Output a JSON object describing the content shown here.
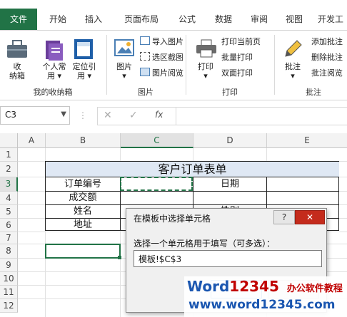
{
  "colors": {
    "accent": "#217346",
    "dialog_close": "#c42b1c",
    "watermark_blue": "#1a56b0",
    "watermark_red": "#c00000"
  },
  "tabs": [
    {
      "label": "文件",
      "active": true
    },
    {
      "label": "开始"
    },
    {
      "label": "插入"
    },
    {
      "label": "页面布局"
    },
    {
      "label": "公式"
    },
    {
      "label": "数据"
    },
    {
      "label": "审阅"
    },
    {
      "label": "视图"
    },
    {
      "label": "开发工"
    }
  ],
  "ribbon": {
    "my_box": {
      "btn1_line1": "收",
      "btn1_line2": "纳箱",
      "btn2_line1": "个人常",
      "btn2_line2": "用",
      "btn3_line1": "定位引",
      "btn3_line2": "用",
      "group": "我的收纳箱"
    },
    "picture": {
      "big": "图片",
      "items": [
        "导入图片",
        "选区截图",
        "图片阅览"
      ],
      "group": "图片"
    },
    "print": {
      "big": "打印",
      "items": [
        "打印当前页",
        "批量打印",
        "双面打印"
      ],
      "group": "打印"
    },
    "comment": {
      "big": "批注",
      "items": [
        "添加批注",
        "删除批注",
        "批注阅览"
      ],
      "group": "批注"
    }
  },
  "formula_bar": {
    "name_box": "C3",
    "fx": "fx",
    "value": ""
  },
  "grid": {
    "columns": [
      "A",
      "B",
      "C",
      "D",
      "E"
    ],
    "rows": [
      "1",
      "2",
      "3",
      "4",
      "5",
      "6",
      "7",
      "8",
      "9",
      "10",
      "11",
      "12"
    ],
    "title": "客户订单表单",
    "labels": {
      "b3": "订单编号",
      "b4": "成交额",
      "b5": "姓名",
      "b6": "地址",
      "d3": "日期",
      "d5": "性别"
    }
  },
  "dialog": {
    "title": "在模板中选择单元格",
    "help": "?",
    "close": "✕",
    "prompt": "选择一个单元格用于填写（可多选）：",
    "value": "模板!$C$3"
  },
  "watermark": {
    "brand_blue": "Word",
    "brand_red": "12345",
    "tagline": "办公软件教程",
    "url": "www.word12345.com"
  }
}
